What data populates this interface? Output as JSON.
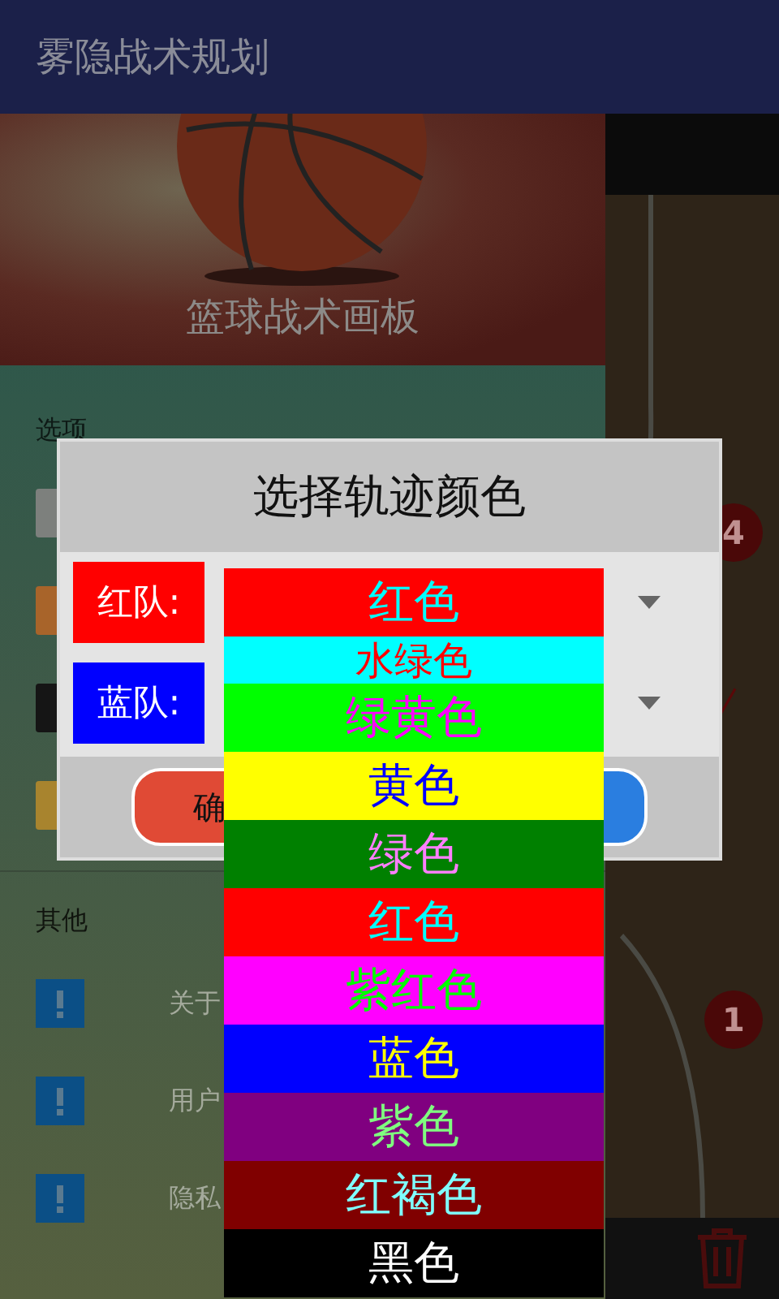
{
  "app_bar": {
    "title": "雾隐战术规划"
  },
  "drawer": {
    "header": {
      "title": "篮球战术画板"
    },
    "options": {
      "heading": "选项",
      "items": [
        {
          "color": "#7d807d"
        },
        {
          "color": "#a8642a"
        },
        {
          "color": "#151515"
        },
        {
          "color": "#a8842e"
        }
      ]
    },
    "other": {
      "heading": "其他",
      "items": [
        {
          "label": "关于"
        },
        {
          "label": "用户"
        },
        {
          "label": "隐私"
        }
      ]
    }
  },
  "court": {
    "badges": [
      {
        "number": "4"
      },
      {
        "number": "1"
      }
    ]
  },
  "dialog": {
    "title": "选择轨迹颜色",
    "teams": [
      {
        "label": "红队:",
        "color": "#ff0000"
      },
      {
        "label": "蓝队:",
        "color": "#0000ff"
      }
    ],
    "buttons": [
      {
        "kind": "confirm",
        "label": "确"
      },
      {
        "kind": "cancel"
      }
    ]
  },
  "dropdown": {
    "current": {
      "label": "红色",
      "color": "#ff0000"
    },
    "options": [
      {
        "label": "水绿色",
        "color": "#00ffff"
      },
      {
        "label": "绿黄色",
        "color": "#00ff00"
      },
      {
        "label": "黄色",
        "color": "#ffff00"
      },
      {
        "label": "绿色",
        "color": "#008000"
      },
      {
        "label": "红色",
        "color": "#ff0000"
      },
      {
        "label": "紫红色",
        "color": "#ff00ff"
      },
      {
        "label": "蓝色",
        "color": "#0000ff"
      },
      {
        "label": "紫色",
        "color": "#800080"
      },
      {
        "label": "红褐色",
        "color": "#800000"
      },
      {
        "label": "黑色",
        "color": "#000000"
      }
    ]
  }
}
